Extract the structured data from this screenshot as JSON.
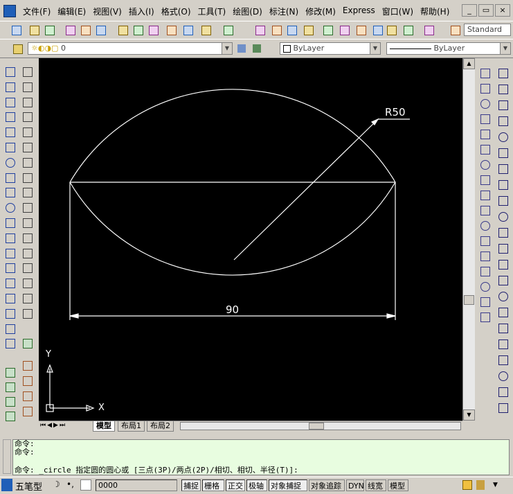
{
  "menus": [
    "文件(F)",
    "编辑(E)",
    "视图(V)",
    "插入(I)",
    "格式(O)",
    "工具(T)",
    "绘图(D)",
    "标注(N)",
    "修改(M)",
    "Express",
    "窗口(W)",
    "帮助(H)"
  ],
  "toolbar": {
    "text_style": "Standard",
    "layer": "0",
    "color": "ByLayer",
    "linetype": "ByLayer"
  },
  "drawing": {
    "radius_label": "R50",
    "linear_dim": "90",
    "ucs_x": "X",
    "ucs_y": "Y"
  },
  "tabs": {
    "model": "模型",
    "layout1": "布局1",
    "layout2": "布局2"
  },
  "command": {
    "line1": "命令:",
    "line2": "命令:",
    "line3": "命令: _circle 指定圆的圆心或 [三点(3P)/两点(2P)/相切、相切、半径(T)]:"
  },
  "status": {
    "ime": "五笔型",
    "coords": "0000",
    "buttons": [
      "捕捉",
      "栅格",
      "正交",
      "极轴",
      "对象捕捉",
      "对象追踪",
      "DYN",
      "线宽",
      "模型"
    ]
  },
  "colors": {
    "canvas": "#000000",
    "linework": "#ffffff",
    "command_bg": "#e8fde0"
  }
}
